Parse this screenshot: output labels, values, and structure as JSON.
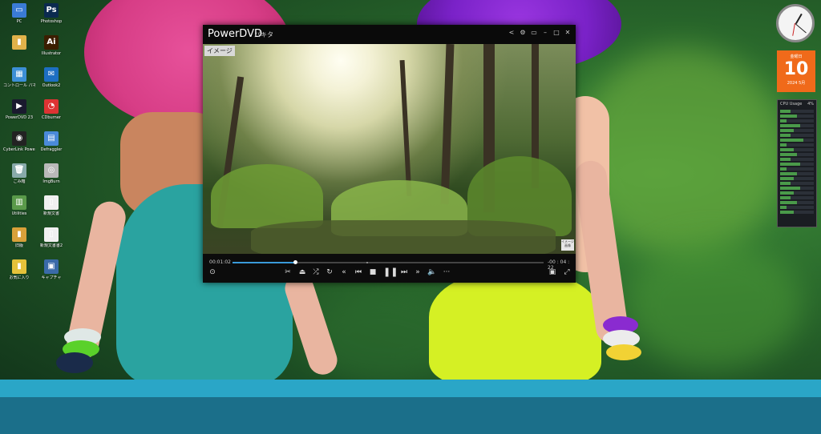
{
  "desktop": {
    "icons": [
      {
        "label": "PC",
        "icon": "pc-icon",
        "color": "#3a7bd5",
        "glyph": "▭"
      },
      {
        "label": "Photoshop",
        "icon": "photoshop-icon",
        "color": "#0b2a4f",
        "glyph": "Ps"
      },
      {
        "label": "",
        "icon": "user-folder-icon",
        "color": "#e0b24a",
        "glyph": "▮"
      },
      {
        "label": "Illustrator",
        "icon": "illustrator-icon",
        "color": "#3b1e00",
        "glyph": "Ai"
      },
      {
        "label": "コントロール パネル",
        "icon": "control-panel-icon",
        "color": "#3d8fd6",
        "glyph": "▦"
      },
      {
        "label": "Outlook2",
        "icon": "outlook-icon",
        "color": "#1d6fc2",
        "glyph": "✉"
      },
      {
        "label": "PowerDVD 23",
        "icon": "powerdvd-icon",
        "color": "#1a1a2e",
        "glyph": "▶"
      },
      {
        "label": "CDburner",
        "icon": "cdburner-icon",
        "color": "#d33",
        "glyph": "◔"
      },
      {
        "label": "CyberLink PowerDirector",
        "icon": "powerdirector-icon",
        "color": "#222",
        "glyph": "◉"
      },
      {
        "label": "Defraggler",
        "icon": "defraggler-icon",
        "color": "#4a8ad9",
        "glyph": "▤"
      },
      {
        "label": "ごみ箱",
        "icon": "recycle-bin-icon",
        "color": "#8aa",
        "glyph": "🗑"
      },
      {
        "label": "ImgBurn",
        "icon": "imgburn-icon",
        "color": "#b9b9b9",
        "glyph": "◎"
      },
      {
        "label": "Utilities",
        "icon": "utilities-folder-icon",
        "color": "#5a9a4a",
        "glyph": "▥"
      },
      {
        "label": "新規文書",
        "icon": "document-icon",
        "color": "#f0f0f0",
        "glyph": "▯"
      },
      {
        "label": "旧版",
        "icon": "folder-icon",
        "color": "#d9a13a",
        "glyph": "▮"
      },
      {
        "label": "新規文書書2",
        "icon": "document2-icon",
        "color": "#f0f0f0",
        "glyph": "▯"
      },
      {
        "label": "お気に入り",
        "icon": "favorites-folder-icon",
        "color": "#e5c23a",
        "glyph": "▮"
      },
      {
        "label": "キャプチャ",
        "icon": "capture-icon",
        "color": "#3a6aa8",
        "glyph": "▣"
      }
    ]
  },
  "gadgets": {
    "calendar": {
      "weekday": "金曜日",
      "day": "10",
      "year_month": "2024 5月",
      "color": "#f06a1a"
    },
    "cpu": {
      "title": "CPU Usage",
      "value": "4%",
      "rows": [
        0.3,
        0.5,
        0.2,
        0.6,
        0.4,
        0.3,
        0.7,
        0.2,
        0.4,
        0.5,
        0.3,
        0.6,
        0.2,
        0.5,
        0.4,
        0.3,
        0.6,
        0.4,
        0.3,
        0.5,
        0.2,
        0.4
      ]
    }
  },
  "player": {
    "app_title": "PowerDVD",
    "file_title": "パキタ",
    "badge": "イメージ",
    "watermark": "イメージ画像",
    "elapsed": "00:01:02",
    "remaining": "-00 : 04 : 22",
    "progress": 0.2,
    "accent": "#3a9ad9"
  }
}
